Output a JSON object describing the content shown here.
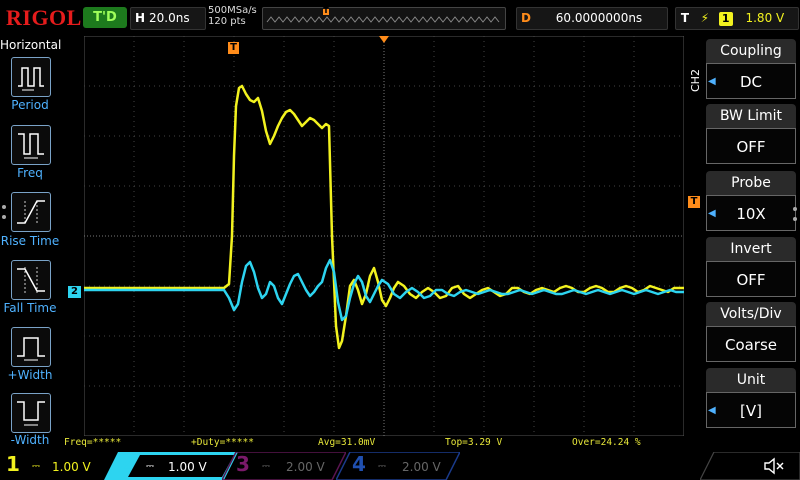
{
  "topbar": {
    "logo": "RIGOL",
    "run_state": "T'D",
    "timebase_letter": "H",
    "timebase_value": "20.0ns",
    "sample_rate": "500MSa/s",
    "memory_depth": "120 pts",
    "trigger_marker": "T",
    "delay_letter": "D",
    "delay_value": "60.0000000ns",
    "trigger_letter": "T",
    "trigger_source": "1",
    "trigger_level": "1.80 V"
  },
  "left_menu": {
    "title": "Horizontal",
    "items": [
      {
        "label": "Period"
      },
      {
        "label": "Freq"
      },
      {
        "label": "Rise Time"
      },
      {
        "label": "Fall Time"
      },
      {
        "label": "+Width"
      },
      {
        "label": "-Width"
      }
    ]
  },
  "right_menu": {
    "channel_tag": "CH2",
    "items": [
      {
        "label": "Coupling",
        "value": "DC",
        "has_arrow": true
      },
      {
        "label": "BW Limit",
        "value": "OFF",
        "has_arrow": false
      },
      {
        "label": "Probe",
        "value": "10X",
        "has_arrow": true
      },
      {
        "label": "Invert",
        "value": "OFF",
        "has_arrow": false
      },
      {
        "label": "Volts/Div",
        "value": "Coarse",
        "has_arrow": false
      },
      {
        "label": "Unit",
        "value": "[V]",
        "has_arrow": true
      }
    ]
  },
  "markers": {
    "trigger_top": "T",
    "ch2_ground": "2",
    "trigger_level_marker": "T"
  },
  "measurements": {
    "freq": "Freq=*****",
    "duty": "+Duty=*****",
    "avg": "Avg=31.0mV",
    "top": "Top=3.29 V",
    "over": "Over=24.24 %"
  },
  "channels": [
    {
      "num": "1",
      "scale": "1.00 V",
      "color": "#f2f21f"
    },
    {
      "num": "2",
      "scale": "1.00 V",
      "color": "#2dd4f0"
    },
    {
      "num": "3",
      "scale": "2.00 V",
      "color": "#b0208f"
    },
    {
      "num": "4",
      "scale": "2.00 V",
      "color": "#2060d0"
    }
  ],
  "colors": {
    "ch1": "#f2f21f",
    "ch2": "#2dd4f0",
    "accent_blue": "#4fb2ff",
    "trigger_orange": "#ff8c1a",
    "logo_red": "#e61c1c"
  },
  "icons": {
    "sound": "speaker-muted-icon"
  }
}
